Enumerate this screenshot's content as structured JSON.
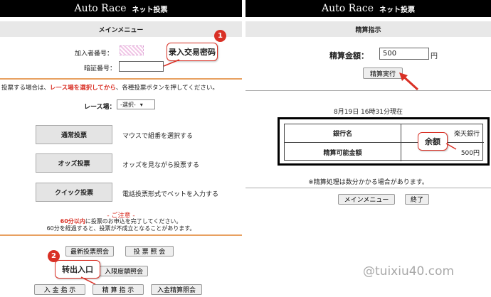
{
  "left": {
    "brand": "Auto Race",
    "subtitle": "ネット投票",
    "menu_title": "メインメニュー",
    "member_label": "加入者番号：",
    "pin_label": "暗証番号：",
    "instruction_pre": "投票する場合は、",
    "instruction_red": "レース場を選択してから",
    "instruction_post": "、各種投票ボタンを押してください。",
    "race_label": "レース場：",
    "race_select": "-選択-",
    "vote_buttons": [
      {
        "label": "通常投票",
        "desc": "マウスで組番を選択する"
      },
      {
        "label": "オッズ投票",
        "desc": "オッズを見ながら投票する"
      },
      {
        "label": "クイック投票",
        "desc": "電話投票形式でベットを入力する"
      }
    ],
    "notice_title": "- ご注意 -",
    "notice_line1_red": "60分以内",
    "notice_line1": "に投票のお申込を完了してください。",
    "notice_line2": "60分を経過すると、投票が不成立となることがあります。",
    "bottom_buttons": {
      "latest": "最新投票照会",
      "vote_inquiry": "投 票 照 会",
      "limit": "入限度額照会",
      "deposit": "入 金 指 示",
      "settle": "精 算 指 示",
      "deposit_settle": "入金精算照会"
    },
    "callout1": {
      "num": "1",
      "text": "录入交易密码"
    },
    "callout2": {
      "num": "2",
      "text": "转出入口"
    }
  },
  "right": {
    "brand": "Auto Race",
    "subtitle": "ネット投票",
    "title": "精算指示",
    "amount_label": "精算金額：",
    "amount_value": "500",
    "unit": "円",
    "execute": "精算実行",
    "timestamp": "8月19日 16時31分現在",
    "table": {
      "bank_label": "銀行名",
      "bank_value": "楽天銀行",
      "avail_label": "精算可能金額",
      "avail_value": "500円"
    },
    "callout": "余额",
    "note": "※精算処理は数分かかる場合があります。",
    "main_menu": "メインメニュー",
    "end": "終了"
  },
  "watermark": "@tuixiu40.com",
  "colors": {
    "accent": "#d93025",
    "orange_rule": "#e8a060"
  }
}
